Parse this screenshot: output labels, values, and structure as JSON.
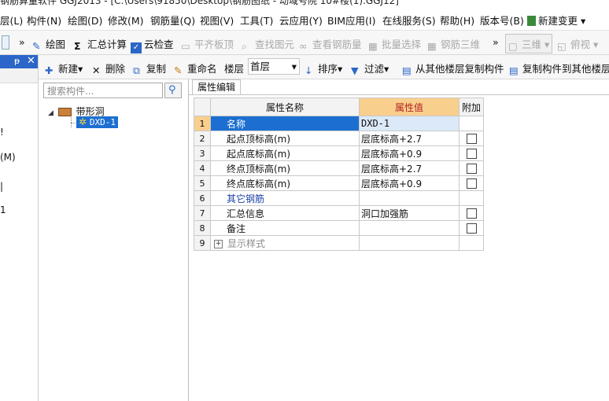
{
  "window": {
    "title": "钢筋算量软件 GGJ2013 - [C:\\Users\\91850\\Desktop\\钢筋图纸 - 动域号院 10#楼(1).GGJ12]"
  },
  "menubar": {
    "items": [
      "层(L)",
      "构件(N)",
      "绘图(D)",
      "修改(M)",
      "钢筋量(Q)",
      "视图(V)",
      "工具(T)",
      "云应用(Y)",
      "BIM应用(I)",
      "在线服务(S)",
      "帮助(H)",
      "版本号(B)"
    ],
    "new_change": "新建变更"
  },
  "toolbar1": {
    "draw": "绘图",
    "sum": "汇总计算",
    "cloud_check": "云检查",
    "flat_slab": "平齐板顶",
    "find_element": "查找图元",
    "view_rebar": "查看钢筋量",
    "batch_select": "批量选择",
    "rebar_3d": "钢筋三维",
    "view_3d": "三维",
    "top_view": "俯视"
  },
  "toolbar2": {
    "new": "新建",
    "delete": "删除",
    "copy": "复制",
    "rename": "重命名",
    "floor_label": "楼层",
    "floor_value": "首层",
    "sort": "排序",
    "filter": "过滤",
    "copy_from_other": "从其他楼层复制构件",
    "copy_to_other": "复制构件到其他楼层"
  },
  "leftdock": {
    "partial_chars": [
      "!",
      "(M)",
      "|",
      "1"
    ]
  },
  "tree": {
    "search_placeholder": "搜索构件...",
    "root": "带形洞",
    "child": "DXD-1"
  },
  "props": {
    "tab": "属性编辑",
    "headers": {
      "name": "属性名称",
      "value": "属性值",
      "extra": "附加"
    },
    "rows": [
      {
        "no": "1",
        "name": "名称",
        "value": "DXD-1",
        "checkbox": false,
        "style": "selected"
      },
      {
        "no": "2",
        "name": "起点顶标高(m)",
        "value": "层底标高+2.7",
        "checkbox": true,
        "style": ""
      },
      {
        "no": "3",
        "name": "起点底标高(m)",
        "value": "层底标高+0.9",
        "checkbox": true,
        "style": ""
      },
      {
        "no": "4",
        "name": "终点顶标高(m)",
        "value": "层底标高+2.7",
        "checkbox": true,
        "style": ""
      },
      {
        "no": "5",
        "name": "终点底标高(m)",
        "value": "层底标高+0.9",
        "checkbox": true,
        "style": ""
      },
      {
        "no": "6",
        "name": "其它钢筋",
        "value": "",
        "checkbox": false,
        "style": "blue"
      },
      {
        "no": "7",
        "name": "汇总信息",
        "value": "洞口加强筋",
        "checkbox": true,
        "style": ""
      },
      {
        "no": "8",
        "name": "备注",
        "value": "",
        "checkbox": true,
        "style": ""
      },
      {
        "no": "9",
        "name": "显示样式",
        "value": "",
        "checkbox": false,
        "style": "grey-expand"
      }
    ]
  },
  "colors": {
    "accent": "#1c6fd1",
    "header_value": "#f9cf8e",
    "dock_head": "#2b66c8"
  }
}
